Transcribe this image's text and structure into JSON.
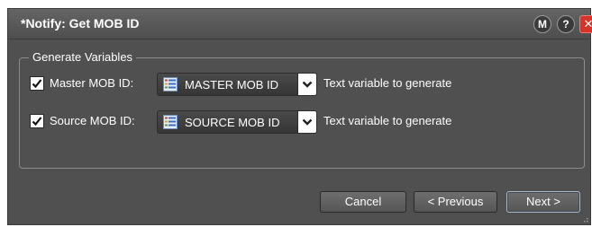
{
  "window": {
    "title": "*Notify: Get MOB ID",
    "buttons": {
      "m": "M",
      "help": "?",
      "close": "✕"
    }
  },
  "group": {
    "legend": "Generate Variables",
    "rows": [
      {
        "checked": true,
        "label": "Master MOB ID:",
        "select_value": "MASTER MOB ID",
        "hint": "Text variable to generate"
      },
      {
        "checked": true,
        "label": "Source MOB ID:",
        "select_value": "SOURCE MOB ID",
        "hint": "Text variable to generate"
      }
    ]
  },
  "footer": {
    "cancel": "Cancel",
    "previous": "< Previous",
    "next": "Next >"
  },
  "icons": {
    "variable": "text-variable-icon",
    "dropdown": "chevron-down-icon",
    "check": "checkmark-icon"
  },
  "colors": {
    "dialog_bg": "#505050",
    "close_button": "#d6332a",
    "text": "#ffffff"
  }
}
